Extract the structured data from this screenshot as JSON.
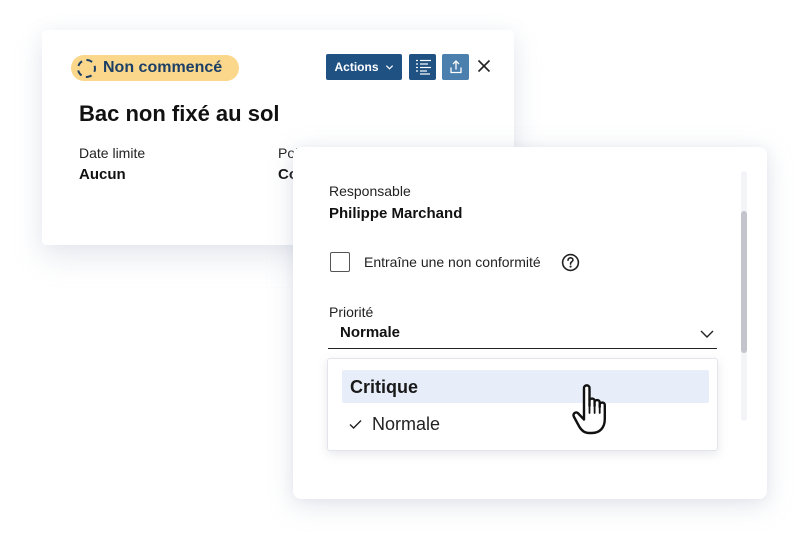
{
  "task": {
    "status_label": "Non commencé",
    "title": "Bac non fixé au sol"
  },
  "toolbar": {
    "actions_label": "Actions"
  },
  "details": {
    "due_date_label": "Date limite",
    "due_date_value": "Aucun",
    "point_label": "Poi",
    "point_value": "Co"
  },
  "panel": {
    "responsible_label": "Responsable",
    "responsible_value": "Philippe Marchand",
    "nonconformity_label": "Entraîne une non conformité",
    "nonconformity_checked": false,
    "priority_label": "Priorité",
    "priority_value": "Normale",
    "priority_options": [
      {
        "label": "Critique",
        "hovered": true,
        "selected": false
      },
      {
        "label": "Normale",
        "hovered": false,
        "selected": true
      }
    ]
  },
  "colors": {
    "status_badge_bg": "#fbd78c",
    "status_text": "#1c3f66",
    "primary_button": "#1f5283",
    "secondary_button": "#4a7fae",
    "option_hover": "#e8eef9"
  },
  "icons": {
    "status": "dashed-circle-icon",
    "actions_chevron": "chevron-down-icon",
    "list": "list-icon",
    "upload": "upload-icon",
    "close": "close-icon",
    "help": "question-circle-icon",
    "select_chevron": "chevron-down-icon",
    "check": "check-icon",
    "cursor": "hand-pointer-icon"
  }
}
